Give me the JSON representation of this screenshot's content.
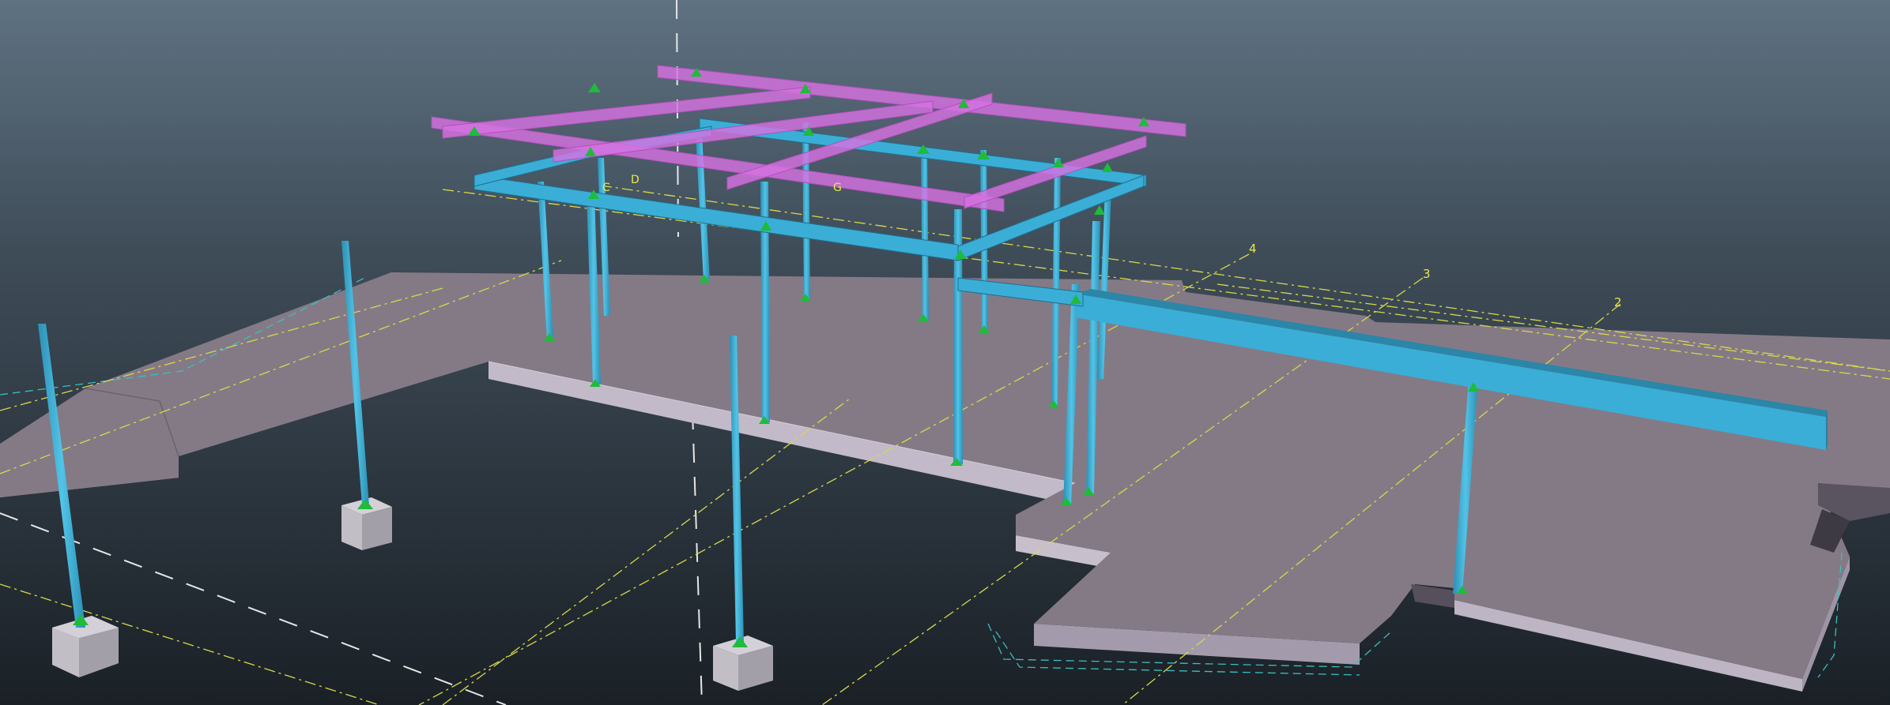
{
  "viewport": {
    "grid_labels": [
      "2",
      "3",
      "4"
    ],
    "annotation_labels": [
      "C",
      "D",
      "G"
    ]
  },
  "colors": {
    "background_top": "#5f7282",
    "background_bottom": "#1a2026",
    "slab_top": "#847a86",
    "slab_side": "#b5adbb",
    "steel_member": "#3aaed6",
    "selected_member": "#d672e0",
    "support_symbol": "#1fbb3a",
    "footing": "#c2bec6",
    "grid_line": "#d8d84a",
    "section_line": "#3bbfbf"
  },
  "icons": {
    "support_marker": "triangle-support-icon"
  }
}
